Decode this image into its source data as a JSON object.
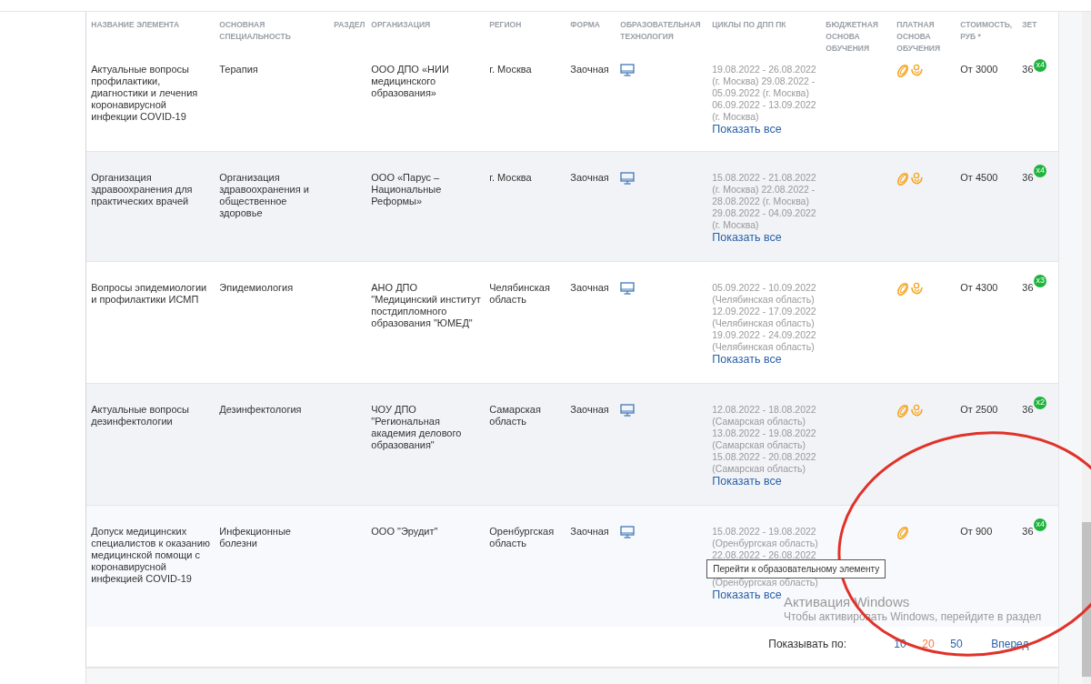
{
  "table": {
    "columns": [
      "НАЗВАНИЕ ЭЛЕМЕНТА",
      "ОСНОВНАЯ СПЕЦИАЛЬНОСТЬ",
      "РАЗДЕЛ",
      "ОРГАНИЗАЦИЯ",
      "РЕГИОН",
      "ФОРМА",
      "ОБРАЗОВАТЕЛЬНАЯ ТЕХНОЛОГИЯ",
      "ЦИКЛЫ ПО ДПП ПК",
      "БЮДЖЕТНАЯ ОСНОВА ОБУЧЕНИЯ",
      "ПЛАТНАЯ ОСНОВА ОБУЧЕНИЯ",
      "СТОИМОСТЬ, РУБ *",
      "ЗЕТ"
    ],
    "rows": [
      {
        "name": "Актуальные вопросы профилактики, диагностики и лечения коронавирусной инфекции COVID-19",
        "specialty": "Терапия",
        "organization": "ООО ДПО «НИИ медицинского образования»",
        "region": "г. Москва",
        "form": "Заочная",
        "cycles": [
          {
            "kind": "line",
            "text": "19.08.2022 - 26.08.2022"
          },
          {
            "kind": "line",
            "text": "(г. Москва) 29.08.2022 -"
          },
          {
            "kind": "line",
            "text": "05.09.2022 (г. Москва)"
          },
          {
            "kind": "line",
            "text": "06.09.2022 - 13.09.2022"
          },
          {
            "kind": "line",
            "text": "(г. Москва)"
          }
        ],
        "show_all": "Показать все",
        "paid": [
          {
            "kind": "coin"
          },
          {
            "kind": "hand"
          }
        ],
        "cost": "От 3000",
        "zet": "36",
        "badge": "x4"
      },
      {
        "name": "Организация здравоохранения для практических врачей",
        "specialty": "Организация здравоохранения и общественное здоровье",
        "organization": "ООО «Парус – Национальные Реформы»",
        "region": "г. Москва",
        "form": "Заочная",
        "cycles": [
          {
            "kind": "line",
            "text": "15.08.2022 - 21.08.2022"
          },
          {
            "kind": "line",
            "text": "(г. Москва) 22.08.2022 -"
          },
          {
            "kind": "line",
            "text": "28.08.2022 (г. Москва)"
          },
          {
            "kind": "line",
            "text": "29.08.2022 - 04.09.2022"
          },
          {
            "kind": "line",
            "text": "(г. Москва)"
          }
        ],
        "show_all": "Показать все",
        "paid": [
          {
            "kind": "coin"
          },
          {
            "kind": "hand"
          }
        ],
        "cost": "От 4500",
        "zet": "36",
        "badge": "x4"
      },
      {
        "name": "Вопросы эпидемиологии и профилактики ИСМП",
        "specialty": "Эпидемиология",
        "organization": "АНО ДПО \"Медицинский институт постдипломного образования \"ЮМЕД\"",
        "region": "Челябинская область",
        "form": "Заочная",
        "cycles": [
          {
            "kind": "line",
            "text": "05.09.2022 - 10.09.2022"
          },
          {
            "kind": "line",
            "text": "(Челябинская область)"
          },
          {
            "kind": "line",
            "text": "12.09.2022 - 17.09.2022"
          },
          {
            "kind": "line",
            "text": "(Челябинская область)"
          },
          {
            "kind": "line",
            "text": "19.09.2022 - 24.09.2022"
          },
          {
            "kind": "line",
            "text": "(Челябинская область)"
          }
        ],
        "show_all": "Показать все",
        "paid": [
          {
            "kind": "coin"
          },
          {
            "kind": "hand"
          }
        ],
        "cost": "От 4300",
        "zet": "36",
        "badge": "x3"
      },
      {
        "name": "Актуальные вопросы дезинфектологии",
        "specialty": "Дезинфектология",
        "organization": "ЧОУ ДПО \"Региональная академия делового образования\"",
        "region": "Самарская область",
        "form": "Заочная",
        "cycles": [
          {
            "kind": "line",
            "text": "12.08.2022 - 18.08.2022"
          },
          {
            "kind": "line",
            "text": "(Самарская область)"
          },
          {
            "kind": "line",
            "text": "13.08.2022 - 19.08.2022"
          },
          {
            "kind": "line",
            "text": "(Самарская область)"
          },
          {
            "kind": "line",
            "text": "15.08.2022 - 20.08.2022"
          },
          {
            "kind": "line",
            "text": "(Самарская область)"
          }
        ],
        "show_all": "Показать все",
        "paid": [
          {
            "kind": "coin"
          },
          {
            "kind": "hand"
          }
        ],
        "cost": "От 2500",
        "zet": "36",
        "badge": "x2"
      },
      {
        "name": "Допуск медицинских специалистов к оказанию медицинской помощи с коронавирусной инфекцией COVID-19",
        "specialty": "Инфекционные болезни",
        "organization": "ООО \"Эрудит\"",
        "region": "Оренбургская область",
        "form": "Заочная",
        "cycles": [
          {
            "kind": "line",
            "text": "15.08.2022 - 19.08.2022"
          },
          {
            "kind": "line",
            "text": "(Оренбургская область)"
          },
          {
            "kind": "line",
            "text": "22.08.2022 - 26.08.2022"
          },
          {
            "kind": "tooltip",
            "text": "Перейти к образовательному элементу"
          },
          {
            "kind": "line",
            "text": "(Оренбургская область)"
          }
        ],
        "show_all": "Показать все",
        "paid": [
          {
            "kind": "coin"
          }
        ],
        "cost": "От 900",
        "zet": "36",
        "badge": "x4"
      }
    ]
  },
  "pagination": {
    "label": "Показывать по:",
    "sizes": [
      {
        "label": "10",
        "selected": false
      },
      {
        "label": "20",
        "selected": true
      },
      {
        "label": "50",
        "selected": false
      }
    ],
    "next": "Вперед"
  },
  "os_notice": {
    "title": "Активация Windows",
    "text": "Чтобы активировать Windows, перейдите в раздел"
  }
}
